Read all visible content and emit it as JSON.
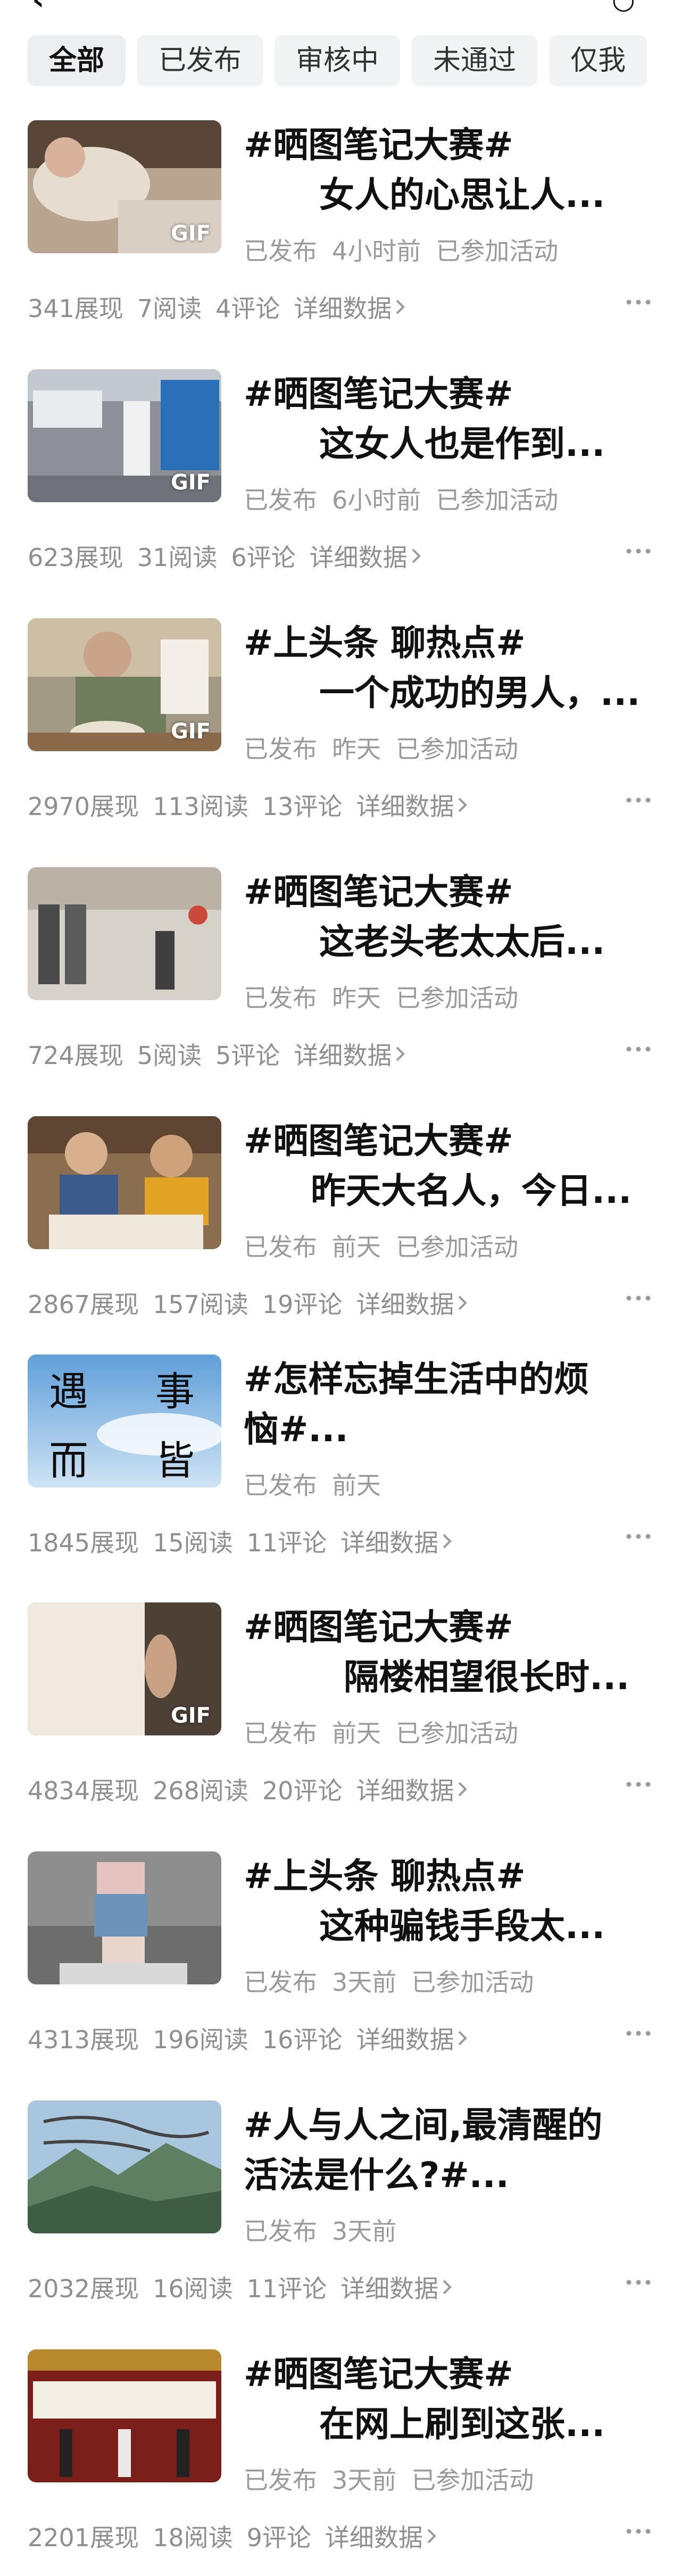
{
  "filters": {
    "items": [
      "全部",
      "已发布",
      "审核中",
      "未通过",
      "仅我"
    ],
    "active_index": 0
  },
  "labels": {
    "detail": "详细数据",
    "gif": "GIF"
  },
  "posts": [
    {
      "title_line1": "#晒图笔记大赛#",
      "title_line2": "女人的心思让人...",
      "status": "已发布",
      "time": "4小时前",
      "activity": "已参加活动",
      "views": "341展现",
      "reads": "7阅读",
      "comments": "4评论",
      "gif": true
    },
    {
      "title_line1": "#晒图笔记大赛#",
      "title_line2": "这女人也是作到...",
      "status": "已发布",
      "time": "6小时前",
      "activity": "已参加活动",
      "views": "623展现",
      "reads": "31阅读",
      "comments": "6评论",
      "gif": true
    },
    {
      "title_line1": "#上头条 聊热点#",
      "title_line2": "一个成功的男人，...",
      "status": "已发布",
      "time": "昨天",
      "activity": "已参加活动",
      "views": "2970展现",
      "reads": "113阅读",
      "comments": "13评论",
      "gif": true
    },
    {
      "title_line1": "#晒图笔记大赛#",
      "title_line2": "这老头老太太后...",
      "status": "已发布",
      "time": "昨天",
      "activity": "已参加活动",
      "views": "724展现",
      "reads": "5阅读",
      "comments": "5评论",
      "gif": false
    },
    {
      "title_line1": "#晒图笔记大赛#",
      "title_line2": "昨天大名人，今日...",
      "status": "已发布",
      "time": "前天",
      "activity": "已参加活动",
      "views": "2867展现",
      "reads": "157阅读",
      "comments": "19评论",
      "gif": false
    },
    {
      "title_line1": "#怎样忘掉生活中的烦",
      "title_line2": "恼#...",
      "status": "已发布",
      "time": "前天",
      "activity": "",
      "views": "1845展现",
      "reads": "15阅读",
      "comments": "11评论",
      "gif": false,
      "thumb_text": [
        "遇",
        "事",
        "而",
        "皆"
      ]
    },
    {
      "title_line1": "#晒图笔记大赛#",
      "title_line2": "隔楼相望很长时...",
      "status": "已发布",
      "time": "前天",
      "activity": "已参加活动",
      "views": "4834展现",
      "reads": "268阅读",
      "comments": "20评论",
      "gif": true
    },
    {
      "title_line1": "#上头条 聊热点#",
      "title_line2": "这种骗钱手段太...",
      "status": "已发布",
      "time": "3天前",
      "activity": "已参加活动",
      "views": "4313展现",
      "reads": "196阅读",
      "comments": "16评论",
      "gif": false
    },
    {
      "title_line1": "#人与人之间,最清醒的",
      "title_line2": "活法是什么?#...",
      "status": "已发布",
      "time": "3天前",
      "activity": "",
      "views": "2032展现",
      "reads": "16阅读",
      "comments": "11评论",
      "gif": false
    },
    {
      "title_line1": "#晒图笔记大赛#",
      "title_line2": "在网上刷到这张...",
      "status": "已发布",
      "time": "3天前",
      "activity": "已参加活动",
      "views": "2201展现",
      "reads": "18阅读",
      "comments": "9评论",
      "gif": false
    }
  ]
}
